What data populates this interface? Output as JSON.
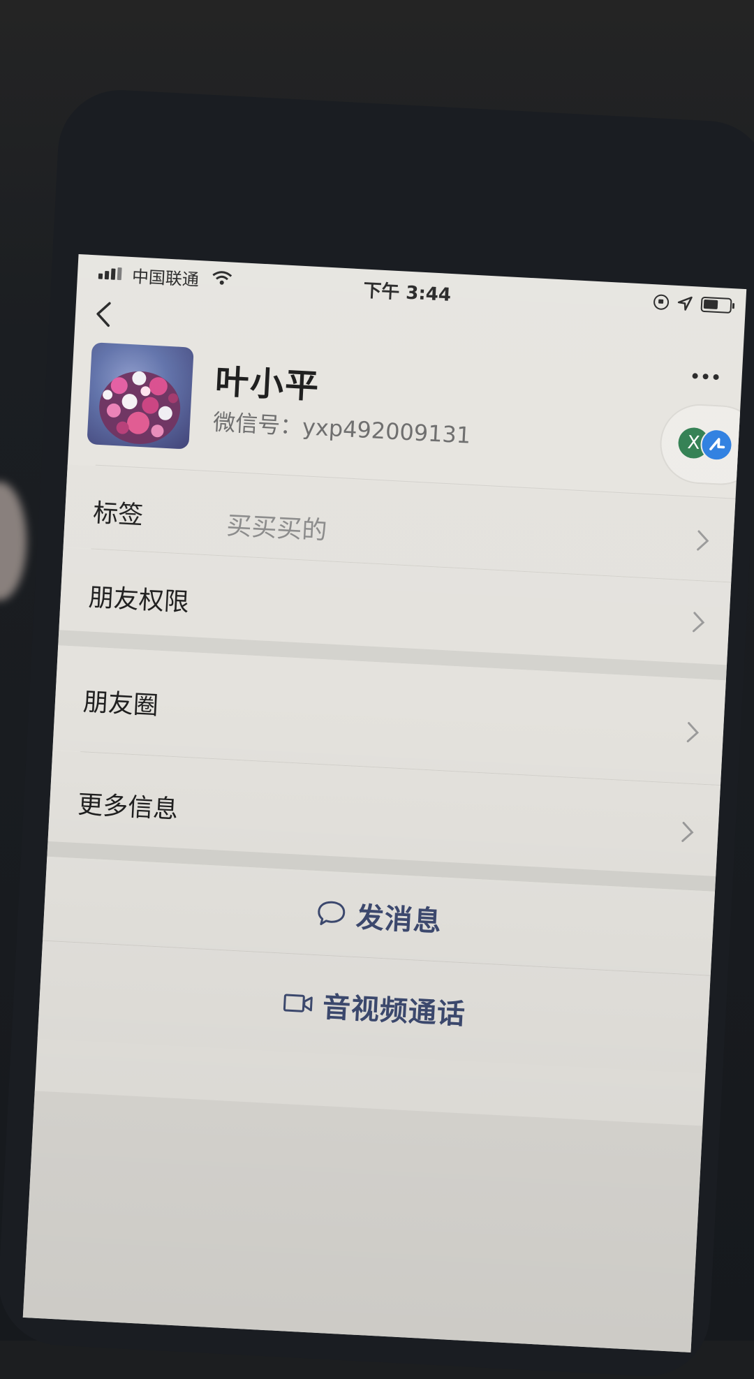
{
  "status_bar": {
    "carrier": "中国联通",
    "time": "下午 3:44"
  },
  "icons": {
    "back": "chevron-left-icon",
    "more": "more-dots-icon",
    "chevron": "chevron-right-icon",
    "message": "chat-bubble-icon",
    "video": "video-camera-icon"
  },
  "profile": {
    "name": "叶小平",
    "wechat_id": "微信号：yxp492009131"
  },
  "floating_widget": {
    "x_label": "X"
  },
  "rows": {
    "tag": {
      "label": "标签",
      "value": "买买买的"
    },
    "permissions": {
      "label": "朋友权限"
    },
    "moments": {
      "label": "朋友圈"
    },
    "more_info": {
      "label": "更多信息"
    }
  },
  "actions": {
    "send_message": "发消息",
    "av_call": "音视频通话"
  },
  "colors": {
    "action_text": "#3d4a70",
    "screen_bg": "#e6e4df"
  }
}
